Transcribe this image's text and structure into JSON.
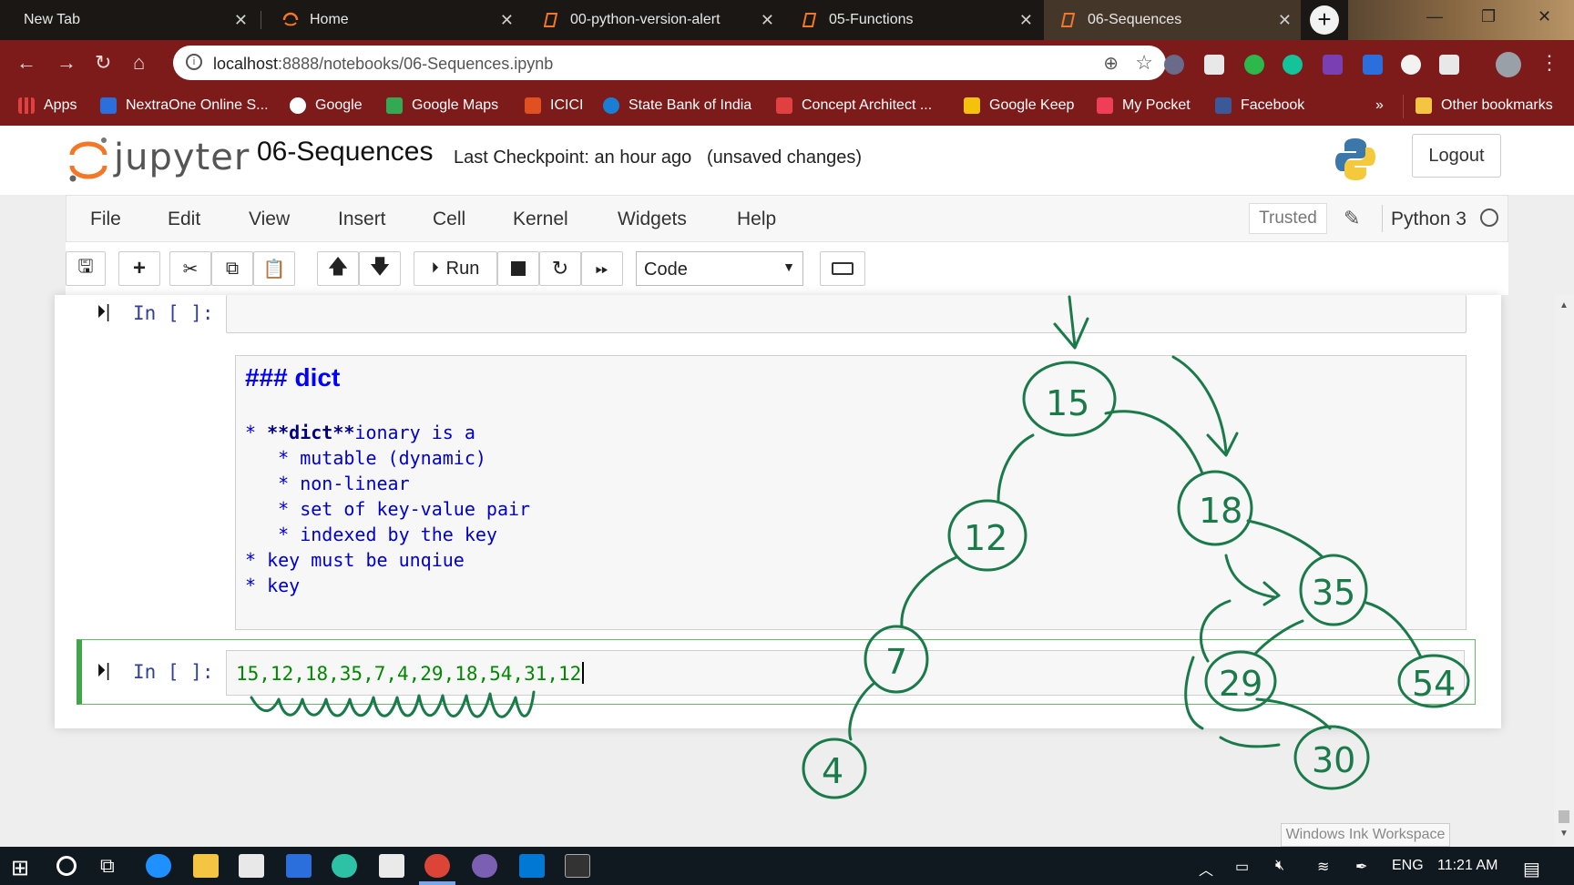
{
  "browser": {
    "tabs": [
      {
        "title": "New Tab",
        "active": false
      },
      {
        "title": "Home",
        "active": false
      },
      {
        "title": "00-python-version-alert",
        "active": false
      },
      {
        "title": "05-Functions",
        "active": false
      },
      {
        "title": "06-Sequences",
        "active": true
      }
    ],
    "url_host": "localhost",
    "url_rest": ":8888/notebooks/06-Sequences.ipynb",
    "bookmarks": [
      {
        "label": "Apps",
        "icon": "apps-grid-icon",
        "color": "#e04040"
      },
      {
        "label": "NextraOne Online S...",
        "icon": "nextraone-icon",
        "color": "#2a6fdb"
      },
      {
        "label": "Google",
        "icon": "google-icon",
        "color": "#ffffff"
      },
      {
        "label": "Google Maps",
        "icon": "google-maps-icon",
        "color": "#34a853"
      },
      {
        "label": "ICICI",
        "icon": "icici-icon",
        "color": "#e05020"
      },
      {
        "label": "State Bank of India",
        "icon": "sbi-icon",
        "color": "#1a7fd4"
      },
      {
        "label": "Concept Architect ...",
        "icon": "gmail-icon",
        "color": "#e04040"
      },
      {
        "label": "Google Keep",
        "icon": "google-keep-icon",
        "color": "#f4c20d"
      },
      {
        "label": "My Pocket",
        "icon": "pocket-icon",
        "color": "#ef3f56"
      },
      {
        "label": "Facebook",
        "icon": "facebook-icon",
        "color": "#3b5998"
      }
    ],
    "more_bookmarks": "»",
    "other_bookmarks": "Other bookmarks"
  },
  "jupyter": {
    "logo_text": "jupyter",
    "notebook_name": "06-Sequences",
    "checkpoint": "Last Checkpoint: an hour ago",
    "unsaved": "(unsaved changes)",
    "logout": "Logout",
    "menu": [
      "File",
      "Edit",
      "View",
      "Insert",
      "Cell",
      "Kernel",
      "Widgets",
      "Help"
    ],
    "trusted": "Trusted",
    "kernel": "Python 3",
    "toolbar": {
      "run_label": "Run",
      "cell_type": "Code"
    }
  },
  "cells": {
    "empty_prompt": "In [ ]:",
    "markdown_heading": "### dict",
    "markdown_lines": [
      {
        "prefix": "* ",
        "bold": "**dict**",
        "text": "ionary is a"
      },
      {
        "prefix": "   * ",
        "bold": "",
        "text": "mutable (dynamic)"
      },
      {
        "prefix": "   * ",
        "bold": "",
        "text": "non-linear"
      },
      {
        "prefix": "   * ",
        "bold": "",
        "text": "set of key-value pair"
      },
      {
        "prefix": "   * ",
        "bold": "",
        "text": "indexed by the key"
      },
      {
        "prefix": "* ",
        "bold": "",
        "text": "key must be unqiue"
      },
      {
        "prefix": "* ",
        "bold": "",
        "text": "key"
      }
    ],
    "code_prompt": "In [ ]:",
    "code_text": "15,12,18,35,7,4,29,18,54,31,12"
  },
  "ink_tree": {
    "nodes": [
      "15",
      "12",
      "18",
      "35",
      "7",
      "4",
      "29",
      "54",
      "30"
    ]
  },
  "ink_workspace_label": "Windows Ink Workspace",
  "taskbar": {
    "language": "ENG",
    "time": "11:21 AM"
  },
  "colors": {
    "ink": "#1a7a4a",
    "jupyter_orange": "#f37726",
    "selected_cell": "#42a549"
  }
}
